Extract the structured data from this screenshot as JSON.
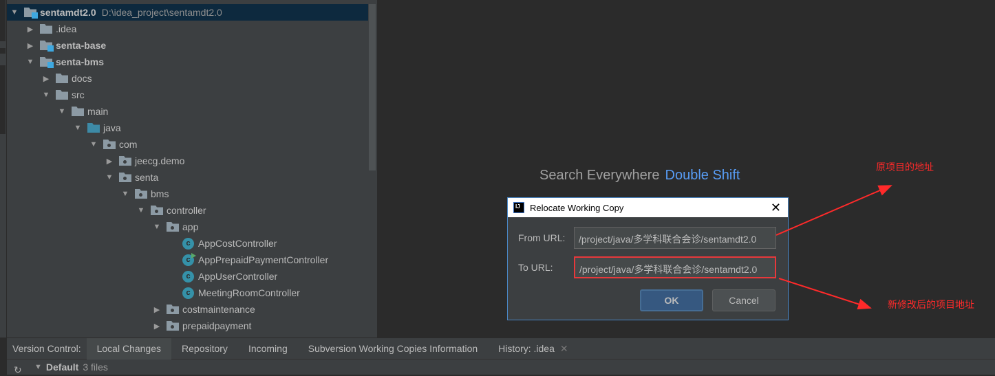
{
  "project_tree": {
    "root": {
      "label": "sentamdt2.0",
      "path": "D:\\idea_project\\sentamdt2.0"
    },
    "items": [
      {
        "label": ".idea",
        "depth": 1,
        "icon": "folder-icon",
        "expanded": false
      },
      {
        "label": "senta-base",
        "depth": 1,
        "icon": "module-icon",
        "expanded": false,
        "bold": true
      },
      {
        "label": "senta-bms",
        "depth": 1,
        "icon": "module-icon",
        "expanded": true,
        "bold": true
      },
      {
        "label": "docs",
        "depth": 2,
        "icon": "folder-icon",
        "expanded": false
      },
      {
        "label": "src",
        "depth": 2,
        "icon": "folder-icon",
        "expanded": true
      },
      {
        "label": "main",
        "depth": 3,
        "icon": "folder-icon",
        "expanded": true
      },
      {
        "label": "java",
        "depth": 4,
        "icon": "source-folder-icon",
        "expanded": true
      },
      {
        "label": "com",
        "depth": 5,
        "icon": "package-icon",
        "expanded": true
      },
      {
        "label": "jeecg.demo",
        "depth": 6,
        "icon": "package-icon",
        "expanded": false
      },
      {
        "label": "senta",
        "depth": 6,
        "icon": "package-icon",
        "expanded": true
      },
      {
        "label": "bms",
        "depth": 7,
        "icon": "package-icon",
        "expanded": true
      },
      {
        "label": "controller",
        "depth": 8,
        "icon": "package-icon",
        "expanded": true
      },
      {
        "label": "app",
        "depth": 9,
        "icon": "package-icon",
        "expanded": true
      },
      {
        "label": "AppCostController",
        "depth": 10,
        "icon": "class-icon"
      },
      {
        "label": "AppPrepaidPaymentController",
        "depth": 10,
        "icon": "class-run-icon"
      },
      {
        "label": "AppUserController",
        "depth": 10,
        "icon": "class-icon"
      },
      {
        "label": "MeetingRoomController",
        "depth": 10,
        "icon": "class-icon"
      },
      {
        "label": "costmaintenance",
        "depth": 9,
        "icon": "package-icon",
        "expanded": false
      },
      {
        "label": "prepaidpayment",
        "depth": 9,
        "icon": "package-icon",
        "expanded": false
      }
    ]
  },
  "editor_hint": {
    "text": "Search Everywhere",
    "shortcut": "Double Shift"
  },
  "dialog": {
    "title": "Relocate Working Copy",
    "from_label": "From URL:",
    "from_value": "/project/java/多学科联合会诊/sentamdt2.0",
    "to_label": "To URL:",
    "to_value": "/project/java/多学科联合会诊/sentamdt2.0",
    "ok": "OK",
    "cancel": "Cancel"
  },
  "bottom_panel": {
    "label": "Version Control:",
    "tabs": [
      "Local Changes",
      "Repository",
      "Incoming",
      "Subversion Working Copies Information",
      "History: .idea"
    ],
    "active_tab": "Local Changes",
    "changelist": {
      "name": "Default",
      "count": "3 files"
    }
  },
  "annotations": {
    "from_note": "原项目的地址",
    "to_note": "新修改后的项目地址",
    "color": "#ff2a2a"
  }
}
